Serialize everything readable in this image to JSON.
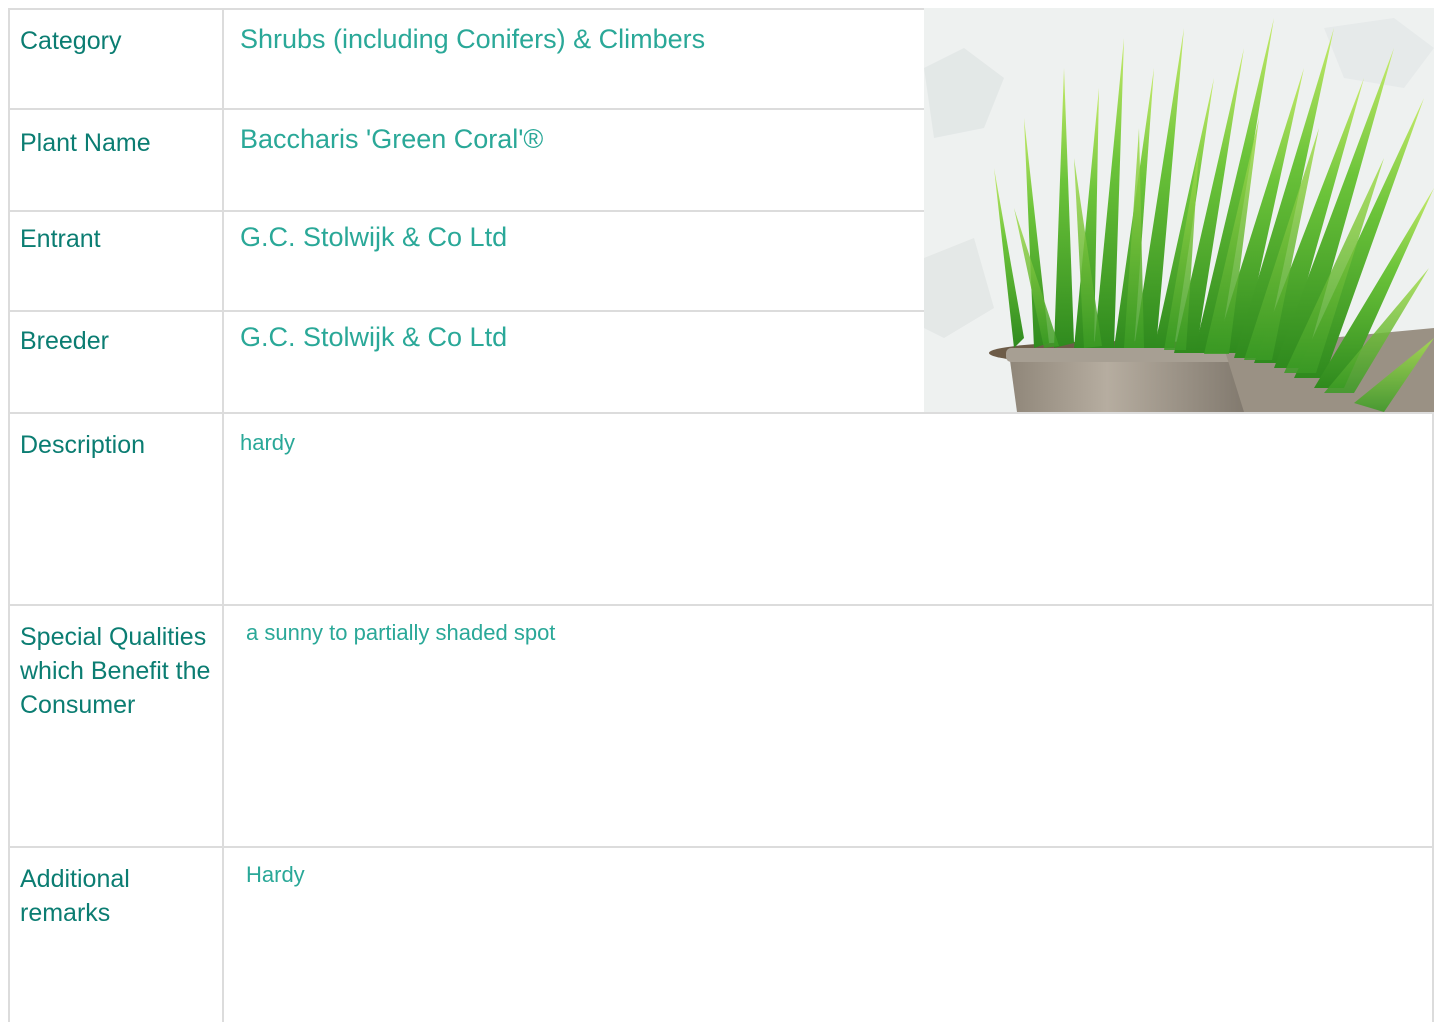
{
  "rows": {
    "category": {
      "label": "Category",
      "value": "Shrubs (including Conifers) & Climbers"
    },
    "plant_name": {
      "label": "Plant Name",
      "value": "Baccharis 'Green Coral'®"
    },
    "entrant": {
      "label": "Entrant",
      "value": "G.C. Stolwijk & Co Ltd"
    },
    "breeder": {
      "label": "Breeder",
      "value": "G.C. Stolwijk & Co Ltd"
    },
    "description": {
      "label": "Description",
      "value": "hardy"
    },
    "special_qualities": {
      "label": "Special Qualities which Benefit the Consumer",
      "value": "a sunny to partially shaded spot"
    },
    "additional_remarks": {
      "label": "Additional remarks",
      "value": "Hardy"
    }
  },
  "colors": {
    "label_text": "#0b7d72",
    "value_text": "#2aa898",
    "grid_line": "#dcdcdc"
  },
  "image": {
    "subject": "potted green succulent plant photo"
  }
}
